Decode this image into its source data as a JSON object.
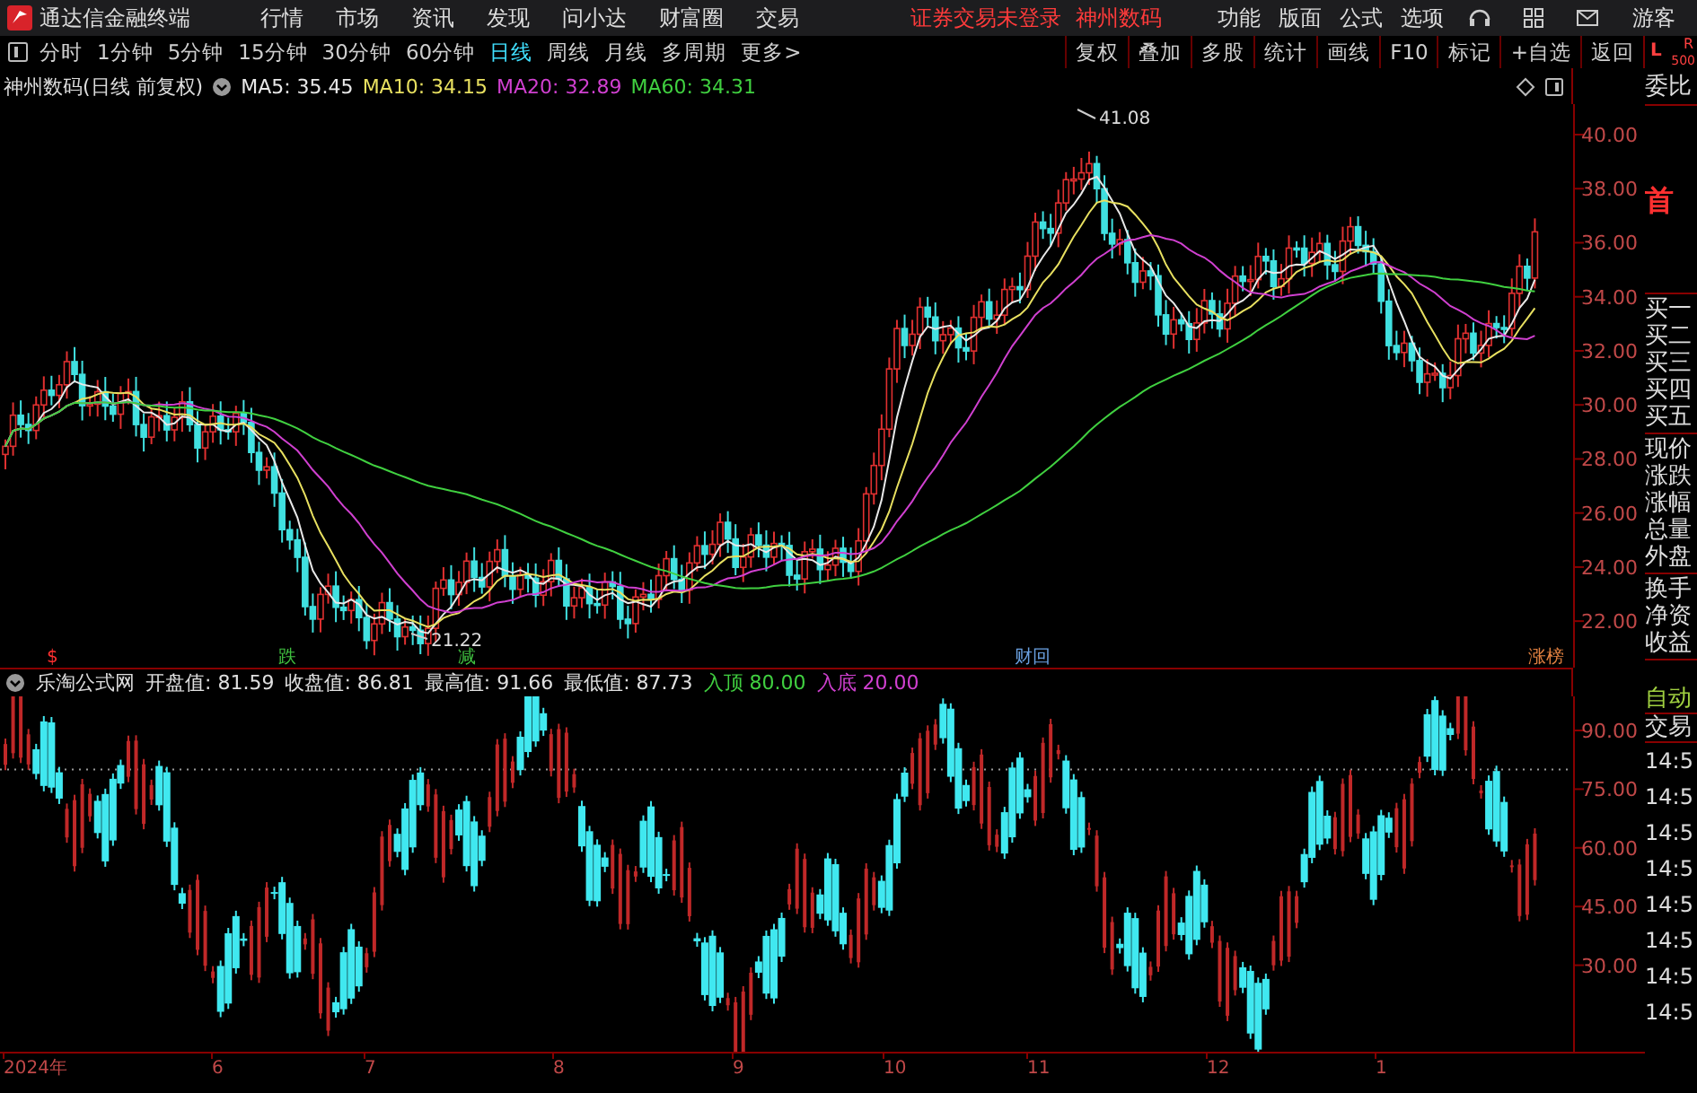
{
  "app": {
    "title": "通达信金融终端",
    "menu": [
      "行情",
      "市场",
      "资讯",
      "发现",
      "问小达",
      "财富圈",
      "交易"
    ],
    "login_notice": "证券交易未登录",
    "stock_name": "神州数码",
    "functions": [
      "功能",
      "版面",
      "公式",
      "选项"
    ],
    "user": "游客"
  },
  "toolbar": {
    "periods": [
      {
        "label": "分时",
        "selected": false
      },
      {
        "label": "1分钟",
        "selected": false
      },
      {
        "label": "5分钟",
        "selected": false
      },
      {
        "label": "15分钟",
        "selected": false
      },
      {
        "label": "30分钟",
        "selected": false
      },
      {
        "label": "60分钟",
        "selected": false
      },
      {
        "label": "日线",
        "selected": true
      },
      {
        "label": "周线",
        "selected": false
      },
      {
        "label": "月线",
        "selected": false
      },
      {
        "label": "多周期",
        "selected": false
      },
      {
        "label": "更多>",
        "selected": false
      }
    ],
    "actions": [
      "复权",
      "叠加",
      "多股",
      "统计",
      "画线",
      "F10",
      "标记",
      "+自选",
      "返回"
    ],
    "corner": [
      "L",
      "R",
      "500"
    ]
  },
  "price_chart": {
    "title": "神州数码(日线 前复权)",
    "ma": [
      {
        "label": "MA5: 35.45",
        "color": "#e8e8e8"
      },
      {
        "label": "MA10: 34.15",
        "color": "#e8e060"
      },
      {
        "label": "MA20: 32.89",
        "color": "#d040d0"
      },
      {
        "label": "MA60: 34.31",
        "color": "#40d040"
      }
    ],
    "high_label": "41.08",
    "low_label": "21.22",
    "markers": [
      {
        "text": "$",
        "color": "#ff3030"
      },
      {
        "text": "跌",
        "color": "#40c040"
      },
      {
        "text": "减",
        "color": "#40c040"
      },
      {
        "text": "财回",
        "color": "#6aa0e0"
      },
      {
        "text": "涨榜",
        "color": "#e08040"
      }
    ],
    "yticks": [
      "40.00",
      "38.00",
      "36.00",
      "34.00",
      "32.00",
      "30.00",
      "28.00",
      "26.00",
      "24.00",
      "22.00"
    ]
  },
  "indicator": {
    "name": "乐淘公式网",
    "values": [
      {
        "label": "开盘值: 81.59",
        "color": "#e0e0e0"
      },
      {
        "label": "收盘值: 86.81",
        "color": "#e0e0e0"
      },
      {
        "label": "最高值: 91.66",
        "color": "#e0e0e0"
      },
      {
        "label": "最低值: 87.73",
        "color": "#e0e0e0"
      },
      {
        "label": "入顶 80.00",
        "color": "#40d040"
      },
      {
        "label": "入底 20.00",
        "color": "#d040d0"
      }
    ],
    "yticks": [
      "90.00",
      "75.00",
      "60.00",
      "45.00",
      "30.00"
    ]
  },
  "dates": [
    "2024年",
    "6",
    "7",
    "8",
    "9",
    "10",
    "11",
    "12",
    "1"
  ],
  "quote_panel": {
    "title": "委比",
    "badge": "首",
    "groups": [
      [
        "买一",
        "买二",
        "买三",
        "买四",
        "买五"
      ],
      [
        "现价",
        "涨跌",
        "涨幅",
        "总量",
        "外盘"
      ],
      [
        "换手",
        "净资",
        "收益"
      ]
    ],
    "auto": "自动",
    "trade": "交易",
    "times": [
      "14:5",
      "14:5",
      "14:5",
      "14:5",
      "14:5",
      "14:5",
      "14:5",
      "14:5"
    ]
  }
}
